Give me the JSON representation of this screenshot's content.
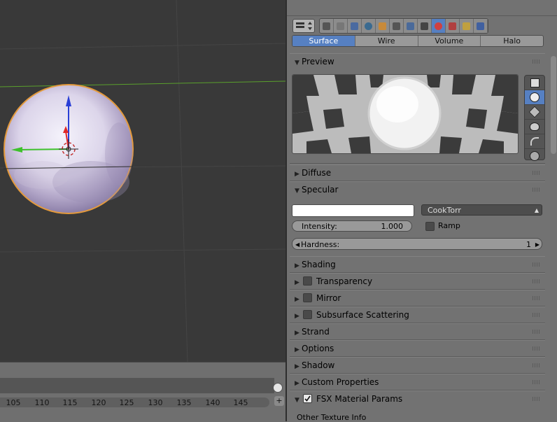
{
  "viewport": {
    "background": "#393939",
    "grid_color": "#454545",
    "x_axis_color": "#5aa02c",
    "sphere_outline": "#e49a3c"
  },
  "timeline": {
    "ticks": [
      "105",
      "110",
      "115",
      "120",
      "125",
      "130",
      "135",
      "140",
      "145"
    ],
    "plus_label": "+"
  },
  "properties": {
    "context_icons": [
      "render-icon",
      "render-layers-icon",
      "scene-icon",
      "world-icon",
      "object-icon",
      "constraints-icon",
      "modifiers-icon",
      "data-icon",
      "material-icon",
      "texture-icon",
      "particles-icon",
      "physics-icon"
    ],
    "active_context": "material-icon",
    "tabs": [
      {
        "label": "Surface",
        "active": true
      },
      {
        "label": "Wire",
        "active": false
      },
      {
        "label": "Volume",
        "active": false
      },
      {
        "label": "Halo",
        "active": false
      }
    ],
    "preview": {
      "title": "Preview",
      "types": [
        "flat-icon",
        "sphere-icon",
        "cube-icon",
        "monkey-icon",
        "hair-icon",
        "sphere-sky-icon"
      ],
      "active_type": "sphere-icon"
    },
    "diffuse": {
      "title": "Diffuse"
    },
    "specular": {
      "title": "Specular",
      "color": "#ffffff",
      "shader": "CookTorr",
      "intensity_label": "Intensity:",
      "intensity_value": "1.000",
      "ramp_label": "Ramp",
      "hardness_label": "Hardness:",
      "hardness_value": "1"
    },
    "panels": [
      {
        "title": "Shading",
        "checkbox": null
      },
      {
        "title": "Transparency",
        "checkbox": false
      },
      {
        "title": "Mirror",
        "checkbox": false
      },
      {
        "title": "Subsurface Scattering",
        "checkbox": false
      },
      {
        "title": "Strand",
        "checkbox": null
      },
      {
        "title": "Options",
        "checkbox": null
      },
      {
        "title": "Shadow",
        "checkbox": null
      },
      {
        "title": "Custom Properties",
        "checkbox": null
      },
      {
        "title": "FSX Material Params",
        "checkbox": true
      }
    ],
    "other_texture_info": "Other Texture Info"
  }
}
